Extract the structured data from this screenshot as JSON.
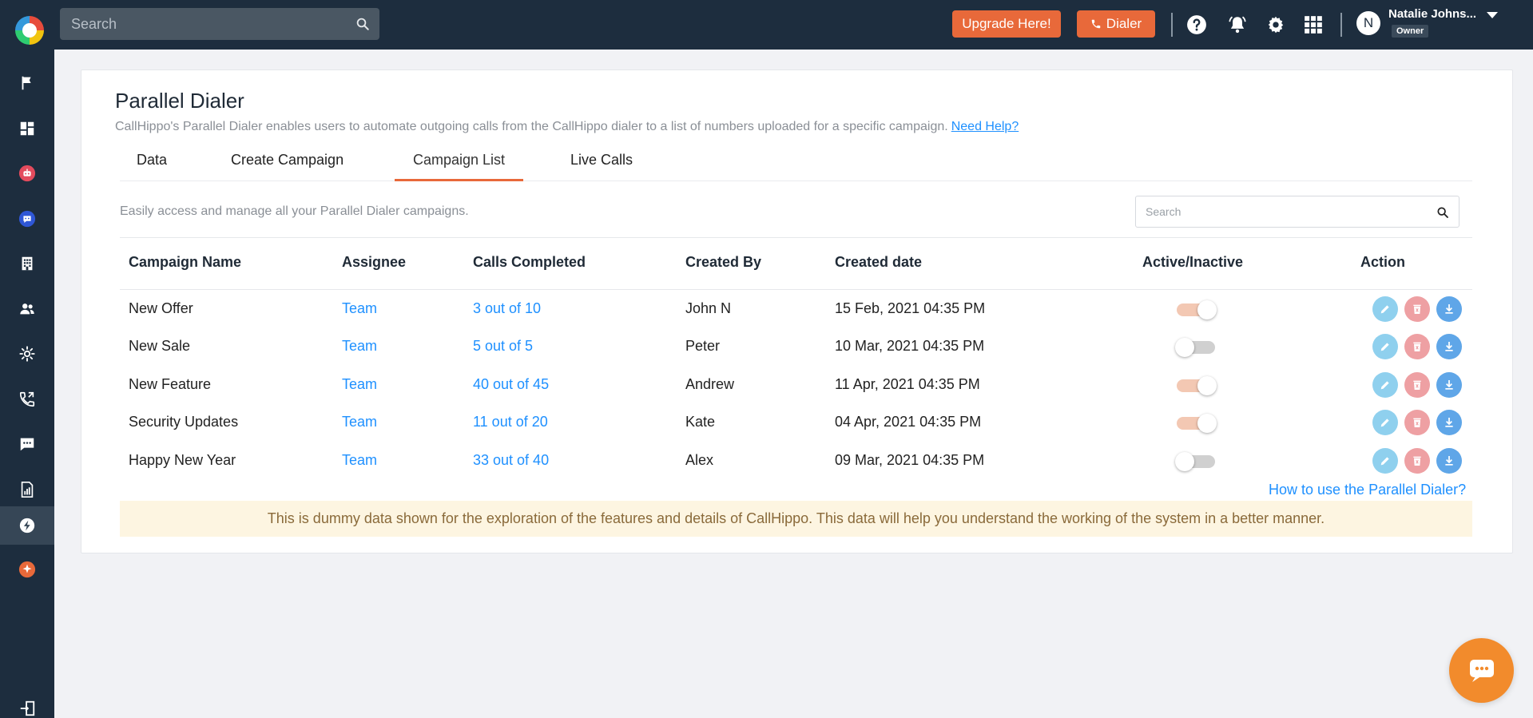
{
  "topbar": {
    "search_placeholder": "Search",
    "upgrade_label": "Upgrade Here!",
    "dialer_label": "Dialer",
    "user": {
      "initial": "N",
      "name": "Natalie Johns...",
      "role": "Owner"
    }
  },
  "colors": {
    "accent": "#e8693a",
    "link": "#1e90ff",
    "dark": "#1d2d3e"
  },
  "sidebar": {
    "items": [
      {
        "icon": "flag-icon"
      },
      {
        "icon": "dashboard-icon"
      },
      {
        "icon": "robot-icon"
      },
      {
        "icon": "chatbot-icon"
      },
      {
        "icon": "building-icon"
      },
      {
        "icon": "users-icon"
      },
      {
        "icon": "integrations-icon"
      },
      {
        "icon": "call-log-icon"
      },
      {
        "icon": "sms-icon"
      },
      {
        "icon": "reports-icon"
      },
      {
        "icon": "parallel-dialer-icon",
        "active": true
      },
      {
        "icon": "ai-sparkle-icon"
      },
      {
        "icon": "logout-icon"
      }
    ]
  },
  "page": {
    "title": "Parallel Dialer",
    "description": "CallHippo's Parallel Dialer enables users to automate outgoing calls from the CallHippo dialer to a list of numbers uploaded for a specific campaign.",
    "help_link": "Need Help?",
    "tabs": [
      "Data",
      "Create Campaign",
      "Campaign List",
      "Live Calls"
    ],
    "active_tab": "Campaign List",
    "sub_description": "Easily access and manage all your Parallel Dialer campaigns.",
    "search_placeholder": "Search"
  },
  "table": {
    "headers": [
      "Campaign Name",
      "Assignee",
      "Calls Completed",
      "Created By",
      "Created date",
      "Active/Inactive",
      "Action"
    ],
    "rows": [
      {
        "name": "New Offer",
        "assignee": "Team",
        "calls": "3 out of 10",
        "created_by": "John N",
        "date": "15 Feb, 2021 04:35 PM",
        "active": true
      },
      {
        "name": "New Sale",
        "assignee": "Team",
        "calls": "5 out of 5",
        "created_by": "Peter",
        "date": "10 Mar, 2021 04:35 PM",
        "active": false
      },
      {
        "name": "New Feature",
        "assignee": "Team",
        "calls": "40 out of 45",
        "created_by": "Andrew",
        "date": "11 Apr, 2021 04:35 PM",
        "active": true
      },
      {
        "name": "Security Updates",
        "assignee": "Team",
        "calls": "11 out of 20",
        "created_by": "Kate",
        "date": "04 Apr, 2021 04:35 PM",
        "active": true
      },
      {
        "name": "Happy New Year",
        "assignee": "Team",
        "calls": "33 out of 40",
        "created_by": "Alex",
        "date": "09 Mar, 2021 04:35 PM",
        "active": false
      }
    ]
  },
  "footer": {
    "howto_link": "How to use the Parallel Dialer?",
    "notice": "This is dummy data shown for the exploration of the features and details of CallHippo. This data will help you understand the working of the system in a better manner."
  }
}
